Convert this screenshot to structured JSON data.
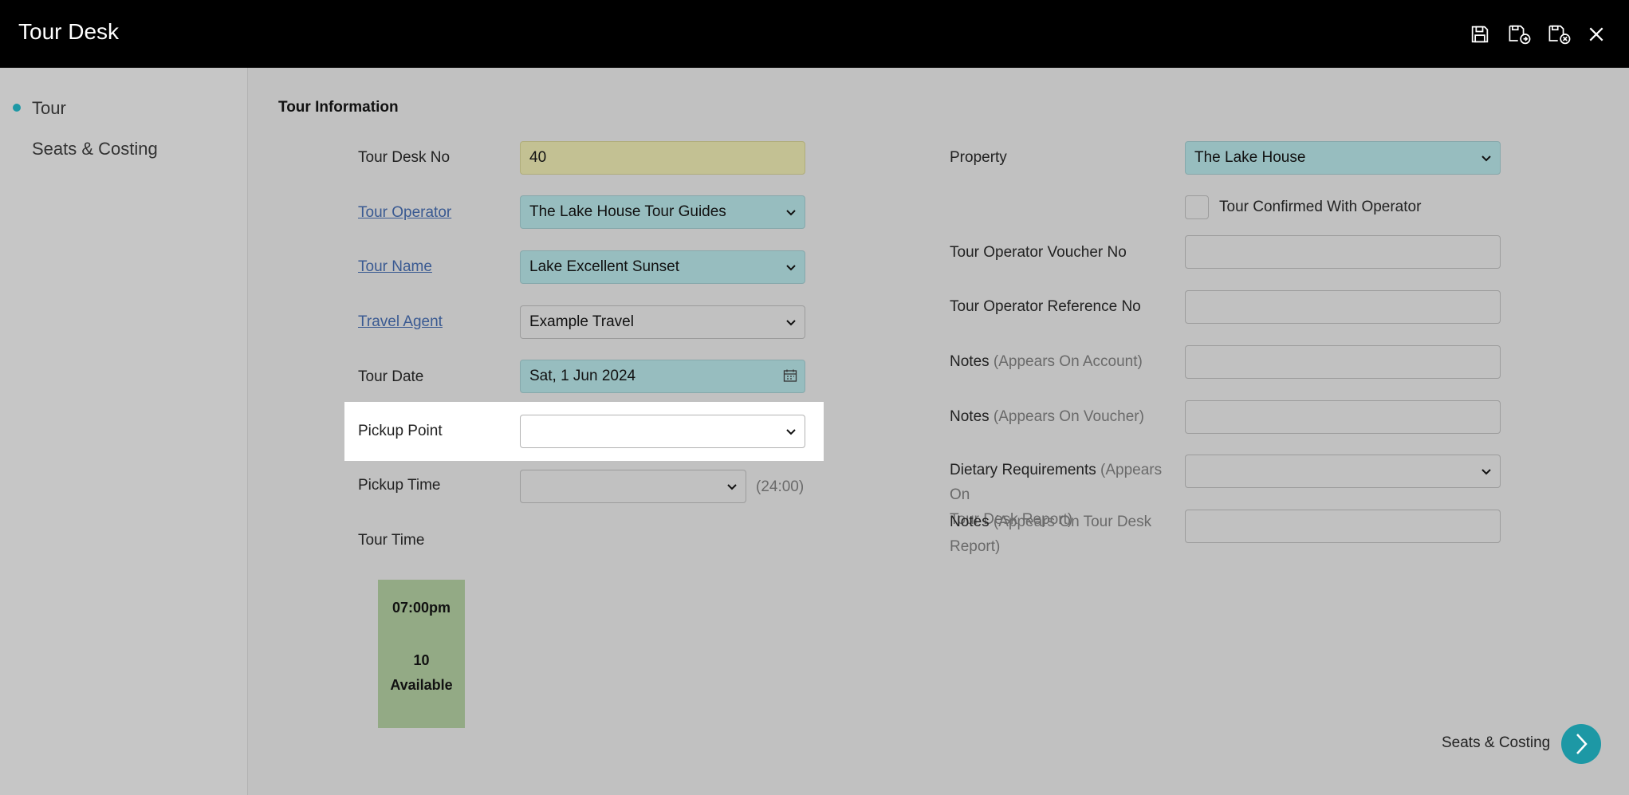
{
  "app": {
    "title": "Tour Desk"
  },
  "toolbar": {
    "save": "save-icon",
    "save_and_new": "save-new-icon",
    "save_and_close": "save-close-icon",
    "close": "close-icon"
  },
  "sidebar": {
    "items": [
      {
        "label": "Tour",
        "active": true
      },
      {
        "label": "Seats & Costing",
        "active": false
      }
    ]
  },
  "section": {
    "title": "Tour Information"
  },
  "left": {
    "tour_desk_no": {
      "label": "Tour Desk No",
      "value": "40"
    },
    "tour_operator": {
      "label": "Tour Operator",
      "value": "The Lake House Tour Guides"
    },
    "tour_name": {
      "label": "Tour Name",
      "value": "Lake Excellent Sunset"
    },
    "travel_agent": {
      "label": "Travel Agent",
      "value": "Example Travel"
    },
    "tour_date": {
      "label": "Tour Date",
      "value": "Sat, 1 Jun 2024"
    },
    "pickup_point": {
      "label": "Pickup Point",
      "value": ""
    },
    "pickup_time": {
      "label": "Pickup Time",
      "value": "",
      "format_hint": "(24:00)"
    },
    "tour_time": {
      "label": "Tour Time",
      "slot_time": "07:00pm",
      "slot_count": "10",
      "slot_status": "Available"
    }
  },
  "right": {
    "property": {
      "label": "Property",
      "value": "The Lake House"
    },
    "confirmed": {
      "label": "Tour Confirmed With Operator",
      "checked": false
    },
    "voucher_no": {
      "label": "Tour Operator Voucher No",
      "value": ""
    },
    "reference_no": {
      "label": "Tour Operator Reference No",
      "value": ""
    },
    "notes_account": {
      "label": "Notes",
      "hint": "(Appears On Account)",
      "value": ""
    },
    "notes_voucher": {
      "label": "Notes",
      "hint": "(Appears On Voucher)",
      "value": ""
    },
    "dietary": {
      "label": "Dietary Requirements",
      "hint_line1": "(Appears On",
      "hint_line2": "Tour Desk Report)",
      "value": ""
    },
    "notes_report": {
      "label": "Notes",
      "hint_line1": "(Appears On Tour Desk",
      "hint_line2": "Report)",
      "value": ""
    }
  },
  "footer": {
    "next_label": "Seats & Costing"
  }
}
